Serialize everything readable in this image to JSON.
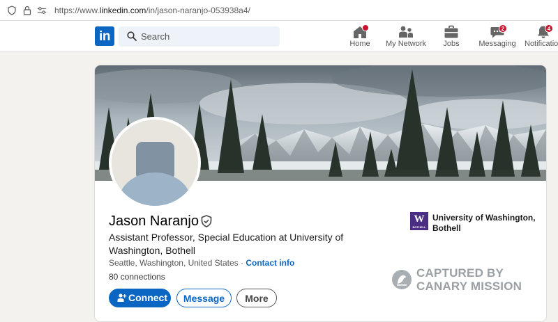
{
  "browser": {
    "url_prefix": "https://www.",
    "url_domain": "linkedin.com",
    "url_path": "/in/jason-naranjo-053938a4/"
  },
  "header": {
    "logo_text": "in",
    "search_placeholder": "Search",
    "nav": [
      {
        "label": "Home",
        "icon": "home-icon",
        "badge": ""
      },
      {
        "label": "My Network",
        "icon": "network-icon",
        "badge": ""
      },
      {
        "label": "Jobs",
        "icon": "briefcase-icon",
        "badge": ""
      },
      {
        "label": "Messaging",
        "icon": "messaging-icon",
        "badge": "2"
      },
      {
        "label": "Notifications",
        "icon": "bell-icon",
        "badge": "4"
      }
    ]
  },
  "profile": {
    "name": "Jason Naranjo",
    "headline": "Assistant Professor, Special Education at University of Washington, Bothell",
    "location": "Seattle, Washington, United States",
    "separator": " · ",
    "contact_label": "Contact info",
    "connections": "80 connections",
    "actions": {
      "connect": "Connect",
      "message": "Message",
      "more": "More"
    },
    "school": {
      "name": "University of Washington, Bothell",
      "logo_letter": "W",
      "logo_caption": "BOTHELL"
    }
  },
  "watermark": {
    "line1": "CAPTURED BY",
    "line2": "CANARY MISSION"
  },
  "colors": {
    "brand": "#0a66c2",
    "badge": "#cb112d",
    "school": "#4b2e83"
  }
}
